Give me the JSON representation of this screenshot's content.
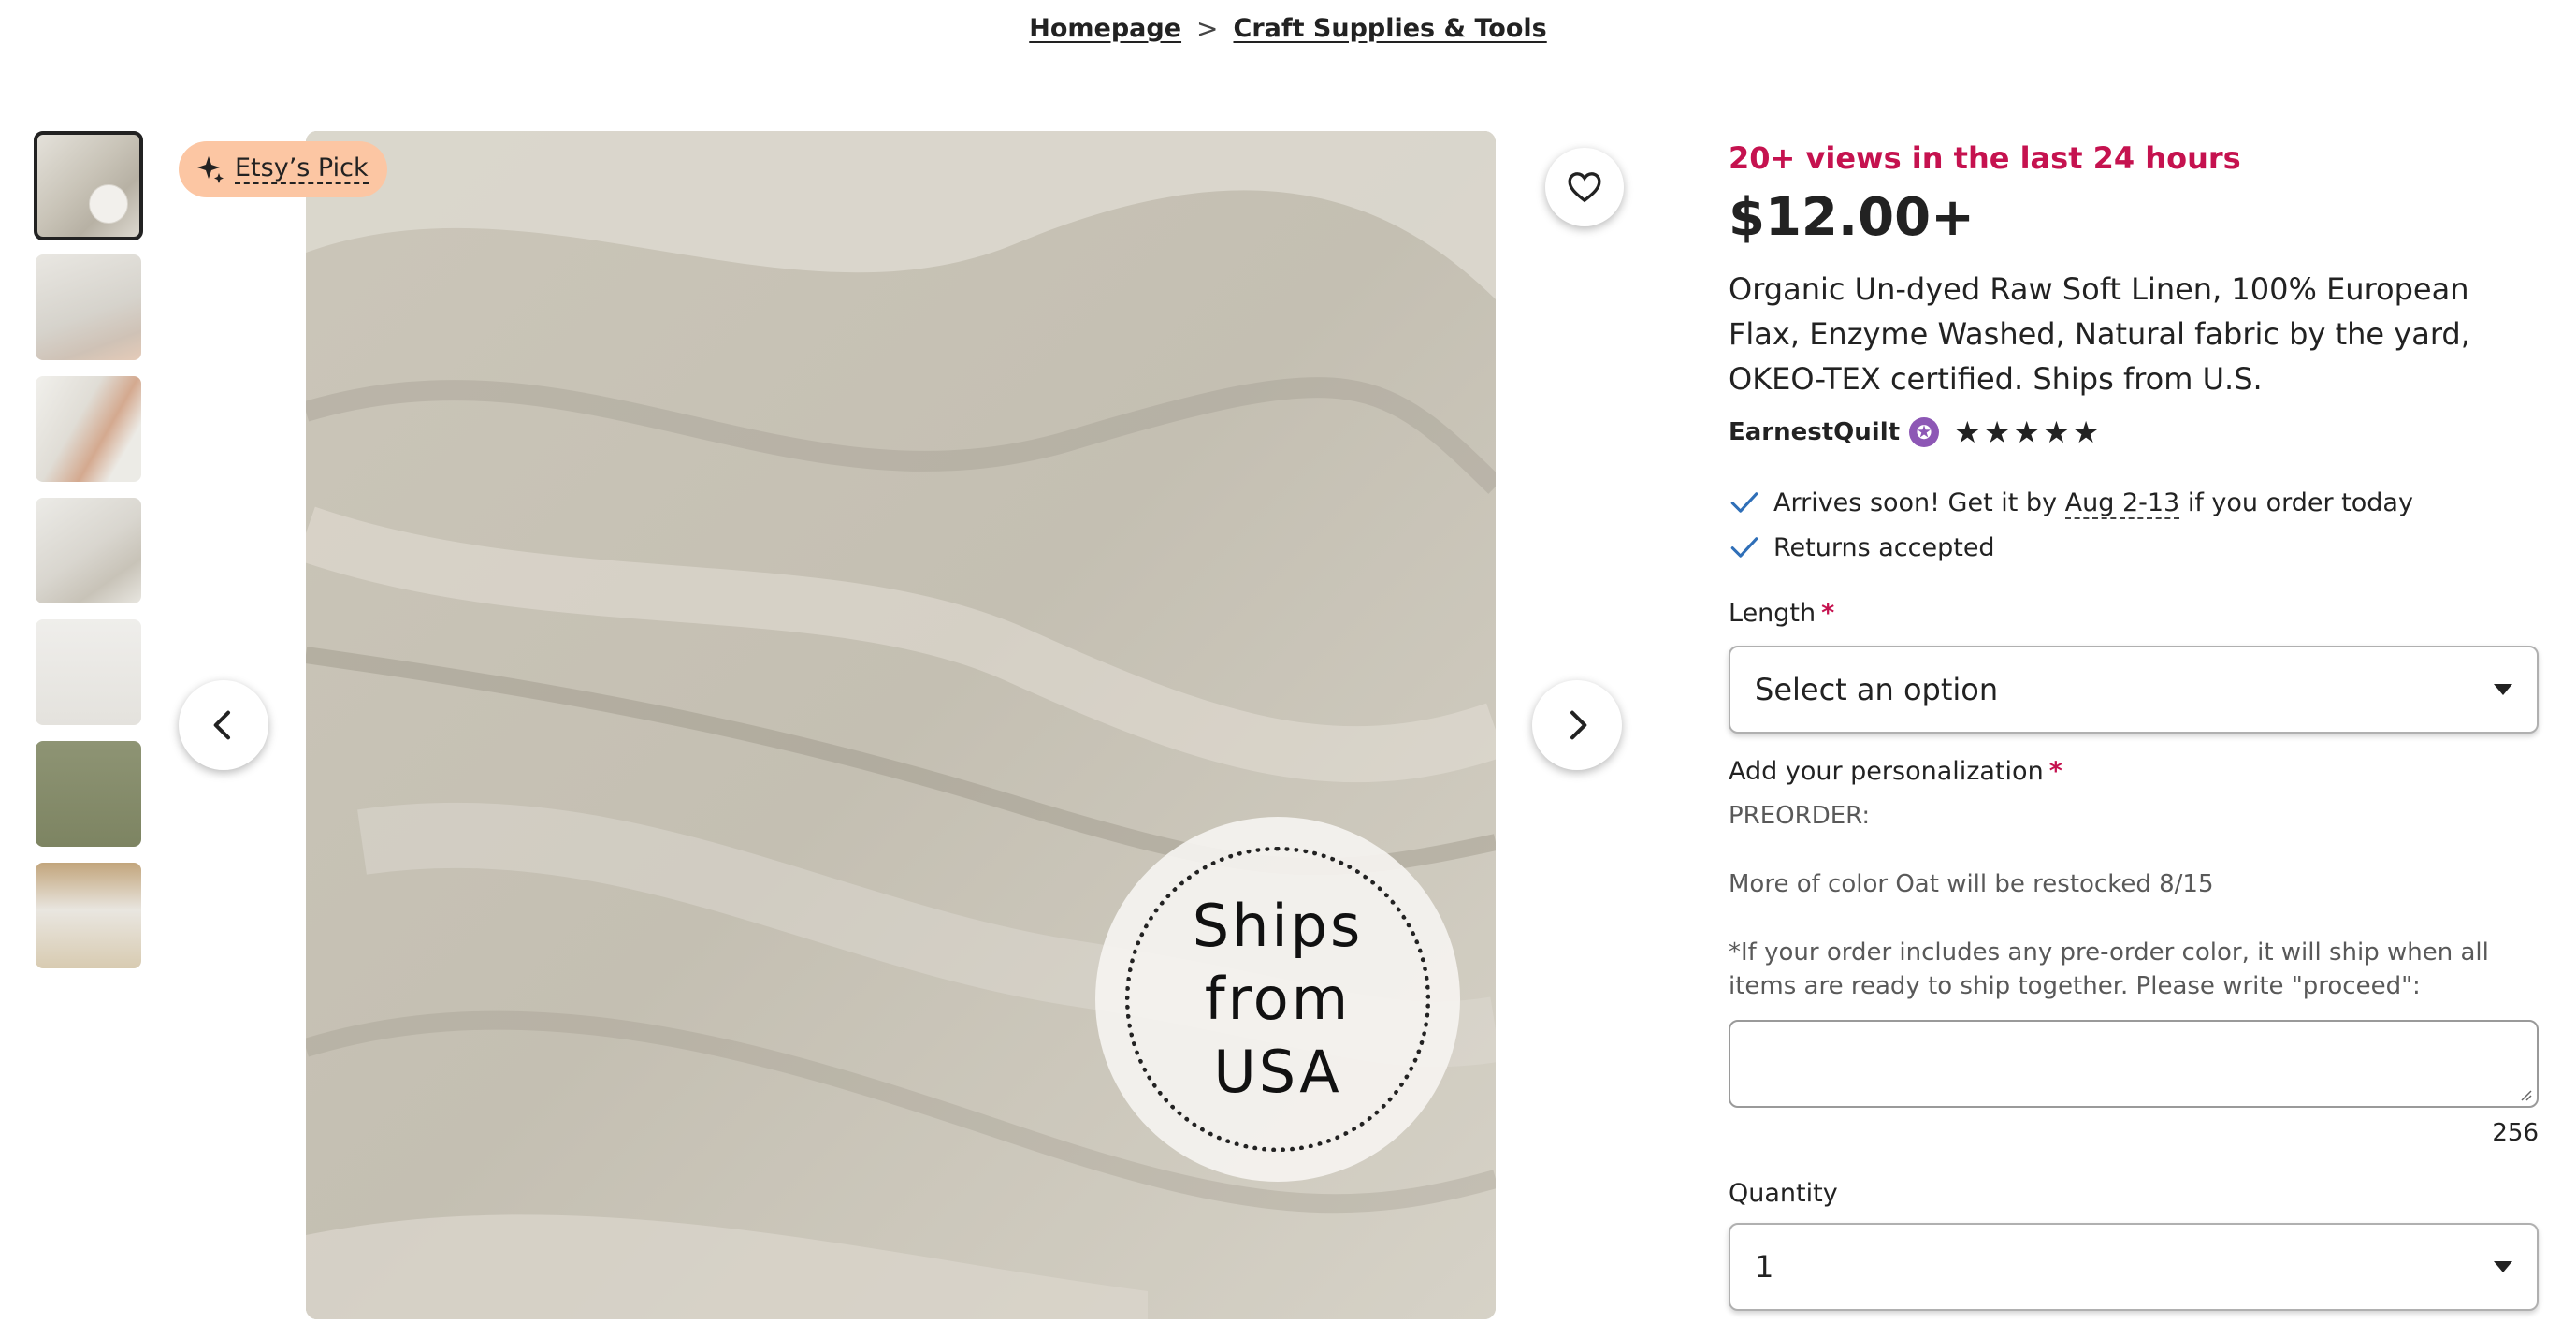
{
  "breadcrumb": {
    "home": "Homepage",
    "separator": ">",
    "category": "Craft Supplies & Tools"
  },
  "gallery": {
    "thumbnail_count": 7,
    "badge_label": "Etsy’s Pick",
    "image_text_line1": "Ships from",
    "image_text_line2": "USA"
  },
  "listing": {
    "views": "20+ views in the last 24 hours",
    "price": "$12.00+",
    "title": "Organic Un-dyed Raw Soft Linen, 100% European Flax, Enzyme Washed, Natural fabric by the yard, OKEO-TEX certified. Ships from U.S.",
    "seller": "EarnestQuilt",
    "rating_stars": 5,
    "features": {
      "arrival_prefix": "Arrives soon! Get it by ",
      "arrival_date": "Aug 2-13",
      "arrival_suffix": " if you order today",
      "returns": "Returns accepted"
    }
  },
  "form": {
    "required_mark": "*",
    "length_label": "Length",
    "length_value": "Select an option",
    "personalization_label": "Add your personalization",
    "note_preorder": "PREORDER:",
    "note_restock": "More of color Oat will be restocked 8/15",
    "note_instructions": "*If your order includes any pre-order color, it will ship when all items are ready to ship together. Please write \"proceed\":",
    "char_counter": "256",
    "quantity_label": "Quantity",
    "quantity_value": "1"
  },
  "colors": {
    "accent_red": "#c5124f",
    "badge_peach": "#fcc6a3",
    "star_seller_purple": "#8d57b5",
    "check_blue": "#2f6fb8"
  }
}
